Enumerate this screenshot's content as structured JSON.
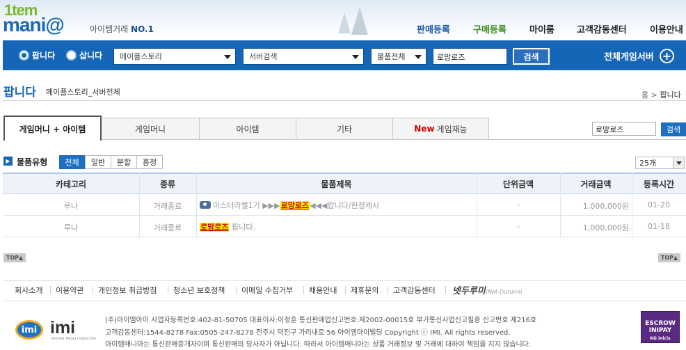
{
  "header": {
    "logo_top": "1tem",
    "logo_bottom": "mani@",
    "slogan": "아이템거래",
    "slogan_bold": "NO.1",
    "nav": [
      {
        "label": "판매등록",
        "color": "#1a57a6"
      },
      {
        "label": "구매등록",
        "color": "#3a8a1a"
      },
      {
        "label": "마이룸",
        "color": "#222222"
      },
      {
        "label": "고객감동센터",
        "color": "#222222"
      },
      {
        "label": "이용안내",
        "color": "#222222"
      }
    ]
  },
  "searchbar": {
    "radio_sell": "팝니다",
    "radio_buy": "삽니다",
    "game": "메이플스토리",
    "server": "서버검색",
    "category": "물품전체",
    "keyword": "로망로즈",
    "search_btn": "검색",
    "all_servers": "전체게임서버"
  },
  "page": {
    "title": "팝니다",
    "subtitle": "메이플스토리_서버전체",
    "breadcrumb_home": "홈",
    "breadcrumb_sep": ">",
    "breadcrumb_current": "팝니다"
  },
  "tabs": [
    {
      "label": "게임머니 + 아이템"
    },
    {
      "label": "게임머니"
    },
    {
      "label": "아이템"
    },
    {
      "label": "기타"
    },
    {
      "label": "게임재능",
      "badge": "New"
    }
  ],
  "right_search": {
    "keyword": "로망로즈",
    "button": "검색"
  },
  "filter": {
    "label": "물품유형",
    "chips": [
      "전체",
      "일반",
      "분할",
      "흥정"
    ],
    "per_page": "25개"
  },
  "table": {
    "headers": [
      "카테고리",
      "종류",
      "물품제목",
      "단위금액",
      "거래금액",
      "등록시간"
    ],
    "rows": [
      {
        "category": "루나",
        "type": "거래종료",
        "title_pre": "마스터라벨1기 ▶▶▶",
        "title_hl": "로망로즈",
        "title_post": "◀◀◀팝니다/한정캐시",
        "unit": "-",
        "price": "1,000,000원",
        "time": "01-20"
      },
      {
        "category": "루나",
        "type": "거래종료",
        "title_pre": "",
        "title_hl": "로망로즈",
        "title_post": "팝니다.",
        "unit": "-",
        "price": "1,000,000원",
        "time": "01-18"
      }
    ]
  },
  "top_button": "TOP",
  "footer": {
    "links": [
      "회사소개",
      "이용약관",
      "개인정보 취급방침",
      "청소년 보호정책",
      "이메일 수집거부",
      "채용안내",
      "제휴문의",
      "고객감동센터"
    ],
    "netsign": "넷두루미",
    "netsign_sub": "(Net-Durumi)",
    "info_lines": [
      "(주)아이엠아이 사업자등록번호:402-81-50705 대표이사:이정훈 통신판매업신고번호:제2002-00015호 부가통신사업신고필증 신고번호 제216호",
      "고객감동센터:1544-8278 Fax:0505-247-8278 전주시 덕진구 가리내로 56 아이엠아이빌딩 Copyright ⓒ IMI. All rights reserved.",
      "아이템매니아는 통신판매중개자이며 통신판매의 당사자가 아닙니다. 따라서 아이템매니아는 상품 거래정보 및 거래에 대하여 책임을 지지 않습니다."
    ],
    "imi_logo": "imi",
    "imi_sub": "Internet Mania Interactive",
    "escrow_line1": "ESCROW",
    "escrow_line2": "INIPAY",
    "escrow_sub": "KG inicis"
  }
}
